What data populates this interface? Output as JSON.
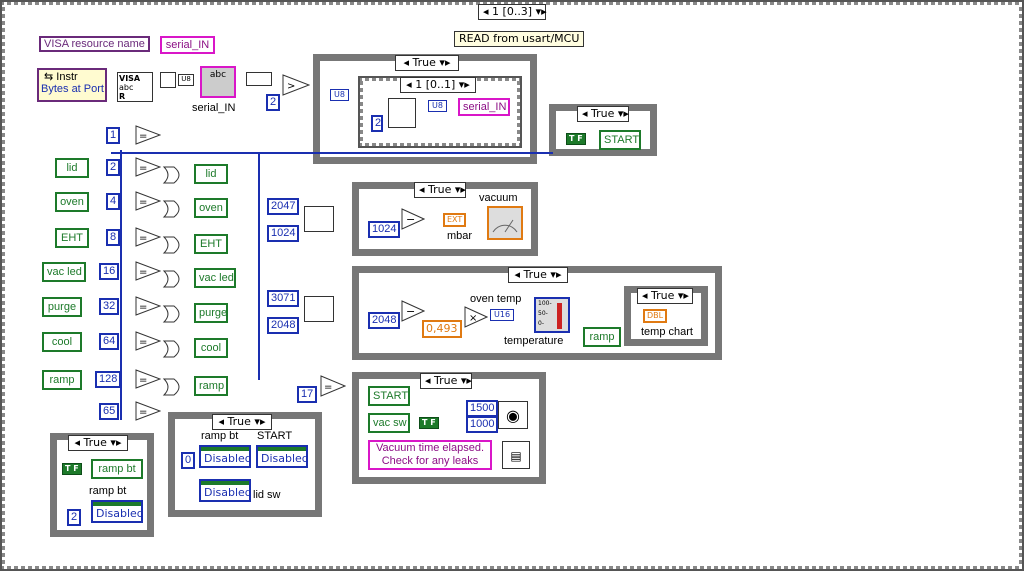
{
  "top_selector": "1 [0..3]",
  "read_label": "READ from usart/MCU",
  "visa_resource": "VISA resource name",
  "serial_in_ctrl": "serial_IN",
  "instr": "Instr",
  "bytes_at_port": "Bytes at Port",
  "serial_in_ind": "serial_IN",
  "serial_in_out": "serial_IN",
  "visa_tag": "VISA",
  "abc": "abc",
  "r": "R",
  "case_true": "True",
  "inner_seq": "1 [0..1]",
  "const_2": "2",
  "u8": "U8",
  "start": "START",
  "mask_consts": [
    "1",
    "2",
    "4",
    "8",
    "16",
    "32",
    "64",
    "128",
    "65"
  ],
  "left_bools": [
    "lid",
    "oven",
    "EHT",
    "vac led",
    "purge",
    "cool",
    "ramp"
  ],
  "right_bools": [
    "lid",
    "oven",
    "EHT",
    "vac led",
    "purge",
    "cool",
    "ramp"
  ],
  "vacuum": {
    "c1": "2047",
    "c2": "1024",
    "c3": "1024",
    "ext": "EXT",
    "mbar": "mbar",
    "title": "vacuum"
  },
  "oven": {
    "c1": "3071",
    "c2": "2048",
    "c3": "2048",
    "factor": "0,493",
    "u16": "U16",
    "title": "oven temp",
    "temp": "temperature",
    "dbl": "DBL",
    "chart": "temp chart",
    "ramp": "ramp",
    "scale": [
      "100-",
      "50-",
      "0-"
    ]
  },
  "c17": "17",
  "alarm": {
    "start": "START",
    "vacsw": "vac sw",
    "n1500": "1500",
    "n1000": "1000",
    "msg": "Vacuum time elapsed. Check for any leaks"
  },
  "ramp_case": {
    "ramp_bt": "ramp bt",
    "label": "ramp bt",
    "const": "2",
    "disabled": "Disabled"
  },
  "mid_case": {
    "ramp_bt": "ramp bt",
    "start": "START",
    "const": "0",
    "disabled": "Disabled",
    "lid_sw": "lid sw"
  },
  "tf": "T F"
}
